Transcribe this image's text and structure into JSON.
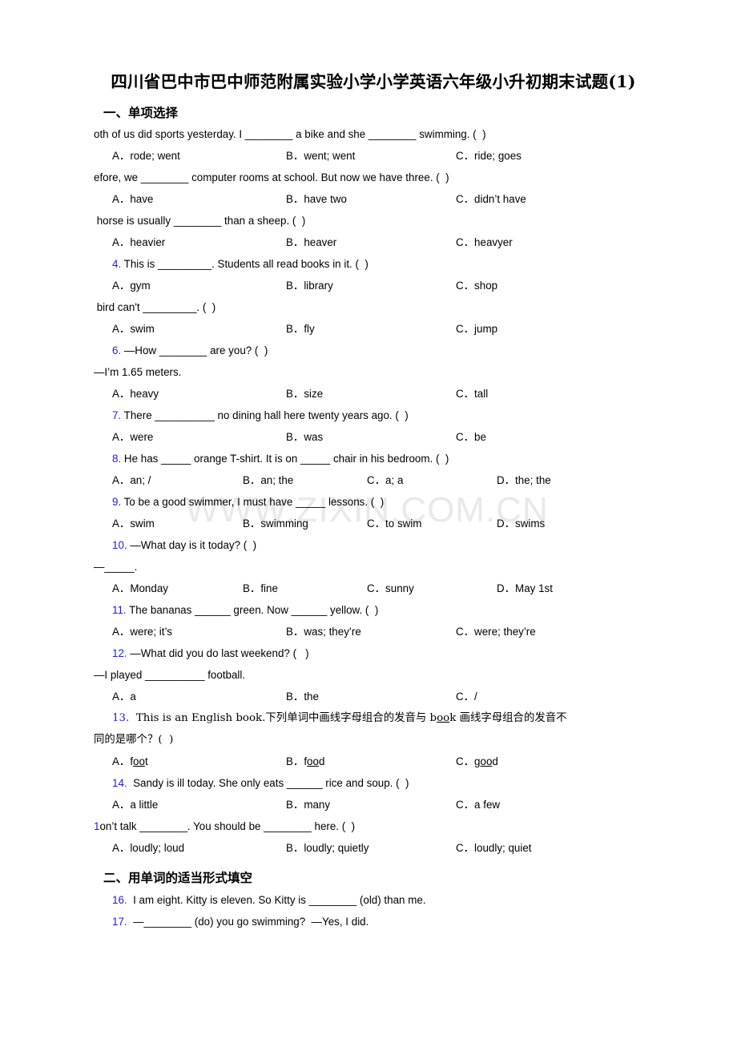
{
  "document": {
    "title": "四川省巴中市巴中师范附属实验小学小学英语六年级小升初期末试题(1)",
    "watermark": "WWW.ZIXIN.COM.CN",
    "accent_color": "#1f1fd6",
    "text_color": "#000000",
    "background_color": "#ffffff"
  },
  "sections": [
    {
      "heading": "一、单项选择",
      "questions": [
        {
          "number": "",
          "stem": "oth of us did sports yesterday. I ________ a bike and she ________ swimming. (  )",
          "columns": 3,
          "options": [
            "A．rode; went",
            "B．went; went",
            "C．ride; goes"
          ]
        },
        {
          "number": "",
          "stem": "efore, we ________ computer rooms at school. But now we have three. (  )",
          "columns": 3,
          "options": [
            "A．have",
            "B．have two",
            "C．didn’t have"
          ]
        },
        {
          "number": "",
          "stem": " horse is usually ________ than a sheep. (  )",
          "columns": 3,
          "options": [
            "A．heavier",
            "B．heaver",
            "C．heavyer"
          ]
        },
        {
          "number": "4.",
          "stem": "This is _________. Students all read books in it. (  )",
          "columns": 3,
          "options": [
            "A．gym",
            "B．library",
            "C．shop"
          ]
        },
        {
          "number": "",
          "stem": " bird can't _________. (  )",
          "columns": 3,
          "options": [
            "A．swim",
            "B．fly",
            "C．jump"
          ]
        },
        {
          "number": "6.",
          "stem": "—How ________ are you? (  )",
          "continuation": "—I’m 1.65 meters.",
          "columns": 3,
          "options": [
            "A．heavy",
            "B．size",
            "C．tall"
          ]
        },
        {
          "number": "7.",
          "stem": "There __________ no dining hall here twenty years ago. (  )",
          "columns": 3,
          "options": [
            "A．were",
            "B．was",
            "C．be"
          ]
        },
        {
          "number": "8.",
          "stem": "He has _____ orange T-shirt. It is on _____ chair in his bedroom. (  )",
          "columns": 4,
          "options": [
            "A．an; /",
            "B．an; the",
            "C．a; a",
            "D．the; the"
          ]
        },
        {
          "number": "9.",
          "stem": "To be a good swimmer, I must have _____ lessons. (  )",
          "columns": 4,
          "options": [
            "A．swim",
            "B．swimming",
            "C．to swim",
            "D．swims"
          ]
        },
        {
          "number": "10.",
          "stem": "—What day is it today? (  )",
          "continuation": "—_____.",
          "columns": 4,
          "options": [
            "A．Monday",
            "B．fine",
            "C．sunny",
            "D．May 1st"
          ]
        },
        {
          "number": "11.",
          "stem": "The bananas ______ green. Now ______ yellow. (  )",
          "columns": 3,
          "options": [
            "A．were; it’s",
            "B．was; they’re",
            "C．were; they’re"
          ]
        },
        {
          "number": "12.",
          "stem": "—What did you do last weekend? (   )",
          "continuation": "—I played __________ football.",
          "columns": 3,
          "options": [
            "A．a",
            "B．the",
            "C．/"
          ]
        },
        {
          "number": "13.",
          "stem_parts": [
            {
              "text": "This is an English book.下列单词中画线字母组合的发音与 b",
              "underline": false
            },
            {
              "text": "oo",
              "underline": true
            },
            {
              "text": "k 画线字母组合的发音不",
              "underline": false
            }
          ],
          "stem_line2": "同的是哪个？(  )",
          "columns": 3,
          "options_parts": [
            [
              {
                "text": "A．f",
                "underline": false
              },
              {
                "text": "oo",
                "underline": true
              },
              {
                "text": "t",
                "underline": false
              }
            ],
            [
              {
                "text": "B．f",
                "underline": false
              },
              {
                "text": "oo",
                "underline": true
              },
              {
                "text": "d",
                "underline": false
              }
            ],
            [
              {
                "text": "C．g",
                "underline": false
              },
              {
                "text": "oo",
                "underline": true
              },
              {
                "text": "d",
                "underline": false
              }
            ]
          ]
        },
        {
          "number": "14.",
          "stem": "Sandy is ill today. She only eats ______ rice and soup. (  )",
          "columns": 3,
          "options": [
            "A．a little",
            "B．many",
            "C．a few"
          ]
        },
        {
          "number": "1",
          "stem": "on’t talk ________. You should be ________ here. (  )",
          "columns": 3,
          "options": [
            "A．loudly; loud",
            "B．loudly; quietly",
            "C．loudly; quiet"
          ]
        }
      ]
    },
    {
      "heading": "二、用单词的适当形式填空",
      "questions": [
        {
          "number": "16.",
          "stem": "I am eight. Kitty is eleven. So Kitty is ________ (old) than me."
        },
        {
          "number": "17.",
          "stem": "—________ (do) you go swimming?  —Yes, I did."
        }
      ]
    }
  ]
}
